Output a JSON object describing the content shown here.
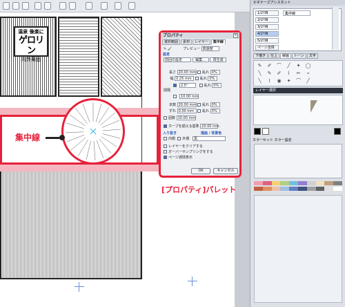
{
  "colors": {
    "accent_red": "#e6213a",
    "pink_band": "#f4b6bf",
    "cursor_beige": "#9c9480"
  },
  "canvas": {
    "sign_line1": "温泉 後楽に",
    "sign_line2": "ゲロリン",
    "sign_line3": "内外薬品",
    "annotation_label": "集中線"
  },
  "property_dialog": {
    "title": "プロパティ",
    "close": "×",
    "tabs": [
      "選択範囲",
      "素材",
      "レイヤー",
      "集中線"
    ],
    "section_setting": "設定",
    "preview_label": "プレビュー",
    "preview_value": "高速度",
    "preset_value": "前回の設定",
    "edit_button": "編集...",
    "regen_button": "再生成",
    "length_label": "長さ",
    "length_value": "20.00 mm",
    "width_label": "幅",
    "width_value": "0.25 mm",
    "interval_label": "間隔",
    "angle_value": "2.5°",
    "interval_mm": "10.00 mm",
    "count_label": "本数",
    "count_value": "20.00 mm",
    "shift_label": "ずれ",
    "shift_value": "0.00 mm",
    "group_label": "固数",
    "group_value": "10.00 mm",
    "random_label": "乱れ",
    "random_value": "0%",
    "curve_label": "カーブを揃える基準",
    "curve_value": "20.00 mm",
    "in_out_label": "入り抜き",
    "in_label": "内側",
    "out_label": "外側",
    "draw_color_label": "描画 / 背景色",
    "draw_color_value": "黒",
    "opt1": "レイヤーをクリアする",
    "opt2": "オーバーサンプリングをする",
    "opt3": "ページ通境表示",
    "ok": "OK",
    "cancel": "キャンセル"
  },
  "panel_label": "[プロパティ]パレット",
  "right": {
    "header": "ビギナーズアシスタント",
    "pages": [
      "1/2?目",
      "2/2?目",
      "3/2?目",
      "4/2?目",
      "5/2?目",
      "ページ全体"
    ],
    "page_right": "集中線",
    "tool_tabs": [
      "下描き",
      "仕上",
      "線画",
      "トーン",
      "文字"
    ],
    "tool_icons": [
      "✎",
      "✐",
      "⌒",
      "╱",
      "✦",
      "◯",
      "╲",
      "✎",
      "✐",
      "⌇",
      "✏",
      "⌁",
      "╲",
      "⌇",
      "◉",
      "✦",
      "⌒",
      "╱"
    ],
    "layer_bar": "レイヤー選択",
    "palette_head": "カラーセット   カラー設定"
  }
}
